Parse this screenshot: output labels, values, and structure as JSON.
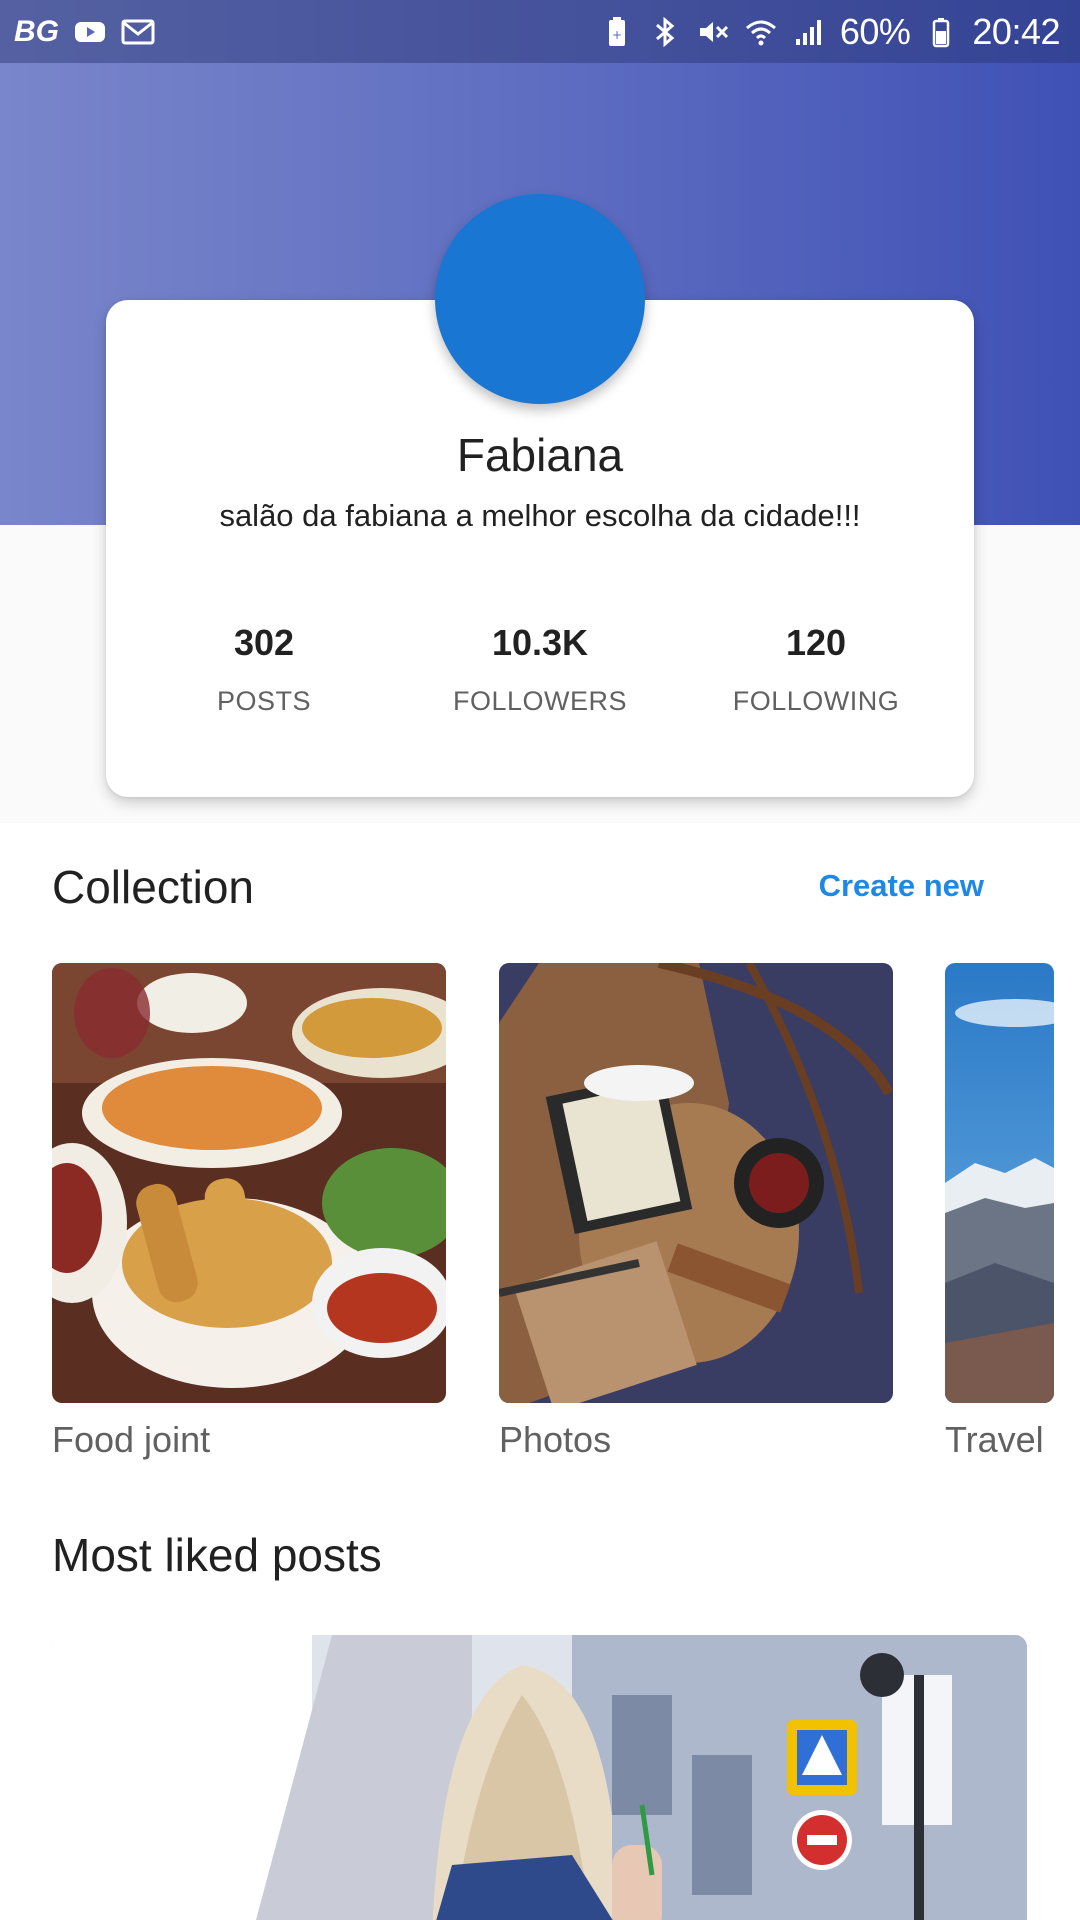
{
  "status_bar": {
    "left_label": "BG",
    "left_icons": [
      "youtube-icon",
      "gmail-icon"
    ],
    "right_icons": [
      "battery-saver-icon",
      "bluetooth-icon",
      "mute-icon",
      "wifi-icon",
      "signal-icon"
    ],
    "battery": "60%",
    "time": "20:42"
  },
  "colors": {
    "header_gradient_start": "#7986cb",
    "header_gradient_end": "#3f51b5",
    "avatar": "#1976d2",
    "accent_link": "#1e88e5"
  },
  "profile": {
    "name": "Fabiana",
    "bio": "salão da fabiana a melhor escolha da cidade!!!",
    "stats": [
      {
        "value": "302",
        "label": "POSTS"
      },
      {
        "value": "10.3K",
        "label": "FOLLOWERS"
      },
      {
        "value": "120",
        "label": "FOLLOWING"
      }
    ]
  },
  "collection": {
    "title": "Collection",
    "create_new": "Create new",
    "items": [
      {
        "label": "Food joint"
      },
      {
        "label": "Photos"
      },
      {
        "label": "Travel"
      }
    ]
  },
  "most_liked": {
    "title": "Most liked posts"
  }
}
